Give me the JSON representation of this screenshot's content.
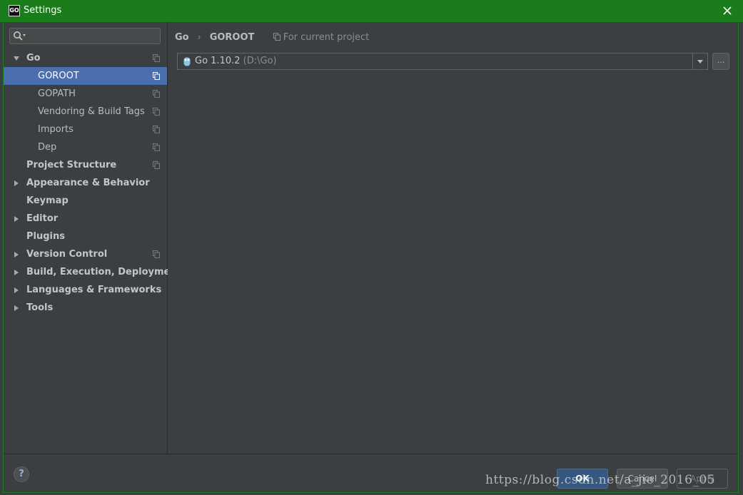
{
  "window": {
    "app_icon_text": "GO",
    "title": "Settings"
  },
  "search": {
    "placeholder": "",
    "value": ""
  },
  "sidebar": {
    "items": [
      {
        "label": "Go"
      },
      {
        "label": "GOROOT"
      },
      {
        "label": "GOPATH"
      },
      {
        "label": "Vendoring & Build Tags"
      },
      {
        "label": "Imports"
      },
      {
        "label": "Dep"
      },
      {
        "label": "Project Structure"
      },
      {
        "label": "Appearance & Behavior"
      },
      {
        "label": "Keymap"
      },
      {
        "label": "Editor"
      },
      {
        "label": "Plugins"
      },
      {
        "label": "Version Control"
      },
      {
        "label": "Build, Execution, Deployment"
      },
      {
        "label": "Languages & Frameworks"
      },
      {
        "label": "Tools"
      }
    ],
    "selected": "GOROOT"
  },
  "breadcrumb": {
    "parent": "Go",
    "separator": "›",
    "current": "GOROOT",
    "scope_note": "For current project"
  },
  "sdk": {
    "name": "Go 1.10.2",
    "path": "(D:\\Go)",
    "browse_label": "..."
  },
  "footer": {
    "help_label": "?",
    "ok_label": "OK",
    "cancel_label": "Cancel",
    "apply_label": "Apply"
  },
  "watermark": "https://blog.csdn.net/a_jie_2016_05",
  "colors": {
    "titlebar": "#1b7c1b",
    "background": "#3c3f41",
    "selection": "#4b6eaf",
    "ok_button": "#365880"
  }
}
